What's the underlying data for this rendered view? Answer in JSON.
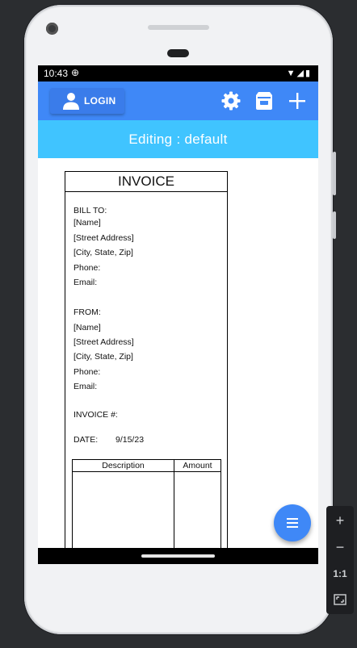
{
  "status_bar": {
    "time": "10:43",
    "sync_icon": "sync-circle-icon",
    "wifi_icon": "wifi-icon",
    "signal_icon": "signal-icon",
    "battery_icon": "battery-icon"
  },
  "app_bar": {
    "login_label": "LOGIN",
    "settings_icon": "gear-icon",
    "archive_icon": "archive-icon",
    "add_icon": "plus-icon",
    "color": "#3f88f7"
  },
  "banner": {
    "text": "Editing : default",
    "color": "#40c4ff"
  },
  "invoice": {
    "title": "INVOICE",
    "bill_to": {
      "heading": "BILL TO:",
      "name": "[Name]",
      "street": "[Street Address]",
      "city": "[City, State, Zip]",
      "phone": "Phone:",
      "email": "Email:"
    },
    "from": {
      "heading": "FROM:",
      "name": "[Name]",
      "street": "[Street Address]",
      "city": "[City, State, Zip]",
      "phone": "Phone:",
      "email": "Email:"
    },
    "invoice_number_label": "INVOICE #:",
    "date_label": "DATE:",
    "date_value": "9/15/23",
    "table": {
      "columns": [
        "Description",
        "Amount"
      ],
      "rows": []
    }
  },
  "fab": {
    "icon": "menu-icon"
  },
  "emulator_toolbar": {
    "zoom_in": "+",
    "zoom_out": "−",
    "one_to_one": "1:1",
    "fit_icon": "fit-screen-icon"
  }
}
